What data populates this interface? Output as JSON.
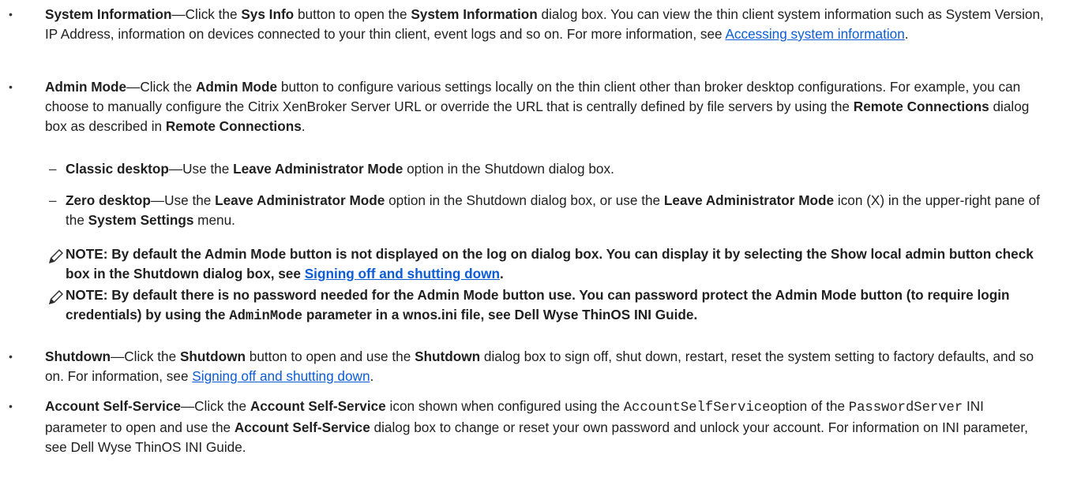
{
  "items": [
    {
      "term": "System Information",
      "seg1": "—Click the ",
      "b1": "Sys Info",
      "seg2": " button to open the ",
      "b2": "System Information",
      "seg3": " dialog box. You can view the thin client system information such as System Version, IP Address, information on devices connected to your thin client, event logs and so on. For more information, see ",
      "link": "Accessing system information",
      "seg4": "."
    },
    {
      "term": "Admin Mode",
      "seg1": "—Click the ",
      "b1": "Admin Mode",
      "seg2": " button to configure various settings locally on the thin client other than broker desktop configurations. For example, you can choose to manually configure the Citrix XenBroker Server URL or override the URL that is centrally defined by file servers by using the ",
      "b2": "Remote Connections",
      "seg3": " dialog box as described in ",
      "b3": "Remote Connections",
      "seg4": "."
    },
    {
      "term": "Shutdown",
      "seg1": "—Click the ",
      "b1": "Shutdown",
      "seg2": " button to open and use the ",
      "b2": "Shutdown",
      "seg3": " dialog box to sign off, shut down, restart, reset the system setting to factory defaults, and so on. For information, see ",
      "link": "Signing off and shutting down",
      "seg4": "."
    },
    {
      "term": "Account Self-Service",
      "seg1": "—Click the ",
      "b1": "Account Self-Service",
      "seg2": " icon shown when configured using the ",
      "code1": "AccountSelfService",
      "seg3": "option of the ",
      "code2": "PasswordServer",
      "seg4": " INI parameter to open and use the ",
      "b2": "Account Self-Service",
      "seg5": " dialog box to change or reset your own password and unlock your account. For information on INI parameter, see Dell Wyse ThinOS INI Guide."
    }
  ],
  "subitems": [
    {
      "dash": "–",
      "term": "Classic desktop",
      "seg1": "—Use the ",
      "b1": "Leave Administrator Mode",
      "seg2": " option in the Shutdown dialog box."
    },
    {
      "dash": "–",
      "term": "Zero desktop",
      "seg1": "—Use the ",
      "b1": "Leave Administrator Mode",
      "seg2": " option in the Shutdown dialog box, or use the ",
      "b2": "Leave Administrator Mode",
      "seg3": " icon (X) in the upper-right pane of the ",
      "b3": "System Settings",
      "seg4": " menu."
    }
  ],
  "notes": [
    {
      "text1": "NOTE: By default the Admin Mode button is not displayed on the log on dialog box. You can display it by selecting the Show local admin button check box in the Shutdown dialog box, see ",
      "link": "Signing off and shutting down",
      "text2": "."
    },
    {
      "text1": "NOTE: By default there is no password needed for the Admin Mode button use. You can password protect the Admin Mode button (to require login credentials) by using the ",
      "code": "AdminMode",
      "text2": " parameter in a wnos.ini file, see Dell Wyse ThinOS INI Guide."
    }
  ],
  "bullet_glyph": "•",
  "colors": {
    "link": "#0b5cd6",
    "text": "#1f1f1f"
  },
  "icons": {
    "note": "pencil-note-icon"
  }
}
